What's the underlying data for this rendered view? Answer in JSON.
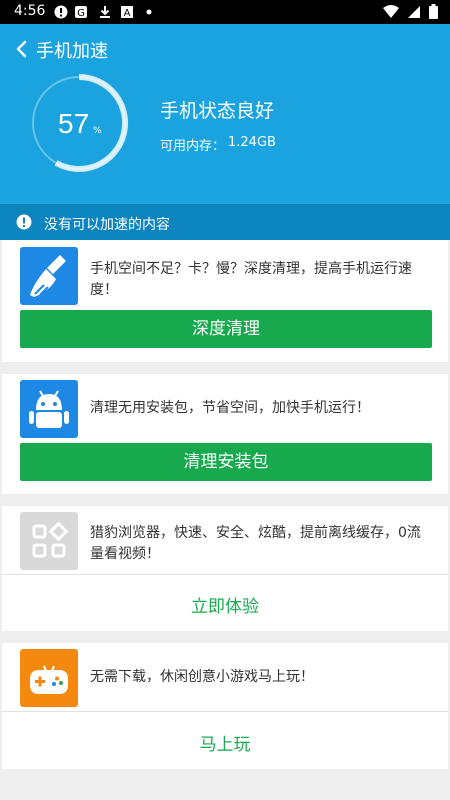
{
  "status_bar": {
    "time": "4:56"
  },
  "header": {
    "title": "手机加速",
    "gauge_value": "57",
    "gauge_unit": "%",
    "status_title": "手机状态良好",
    "memory_label": "可用内存：",
    "memory_value": "1.24GB",
    "background_color": "#1aa3df"
  },
  "notice": {
    "text": "没有可以加速的内容"
  },
  "cards": [
    {
      "icon": "broom-icon",
      "text": "手机空间不足？卡？慢？深度清理，提高手机运行速度！",
      "button": "深度清理"
    },
    {
      "icon": "android-icon",
      "text": "清理无用安装包，节省空间，加快手机运行！",
      "button": "清理安装包"
    },
    {
      "icon": "browser-apps-icon",
      "text": "猎豹浏览器，快速、安全、炫酷，提前离线缓存，0流量看视频！",
      "button": "立即体验"
    },
    {
      "icon": "gamepad-icon",
      "text": "无需下载，休闲创意小游戏马上玩！",
      "button": "马上玩"
    }
  ],
  "colors": {
    "accent_green": "#18a84d",
    "header_blue": "#1aa3df",
    "notice_blue": "#0c85bf"
  }
}
